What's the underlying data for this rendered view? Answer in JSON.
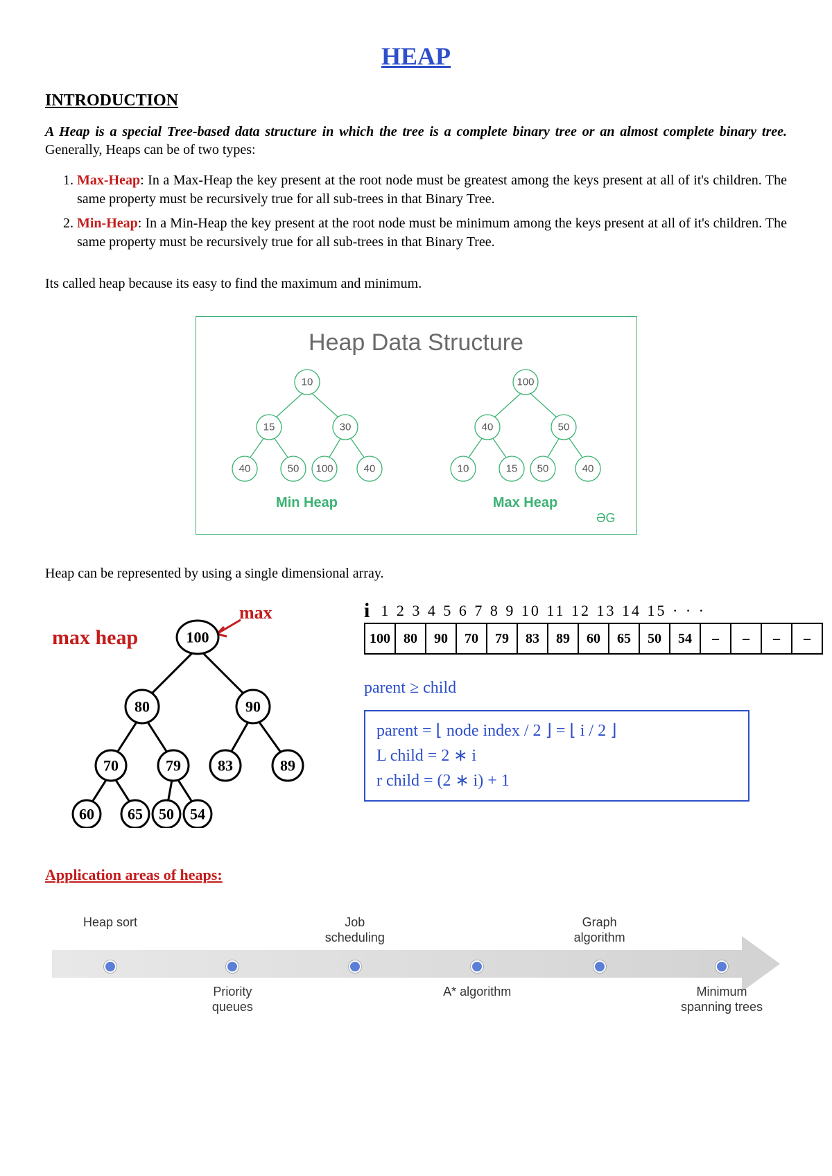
{
  "title": "HEAP",
  "section_intro": "INTRODUCTION",
  "intro_lead": "A Heap is a special Tree-based data structure in which the tree is a complete binary tree or an almost complete binary tree.",
  "intro_tail": " Generally, Heaps can be of two types:",
  "types": [
    {
      "name": "Max-Heap",
      "desc": ": In a Max-Heap the key present at the root node must be greatest among the keys present at all of it's children. The same property must be recursively true for all sub-trees in that Binary Tree."
    },
    {
      "name": "Min-Heap",
      "desc": ": In a Min-Heap the key present at the root node must be minimum among the keys present at all of it's children. The same property must be recursively true for all sub-trees in that Binary Tree."
    }
  ],
  "why_heap": "Its called heap because its easy to find the maximum and minimum.",
  "box_title": "Heap Data Structure",
  "min_heap_label": "Min Heap",
  "max_heap_label": "Max Heap",
  "gfg_mark": "ƏG",
  "min_heap_nodes": [
    "10",
    "15",
    "30",
    "40",
    "50",
    "100",
    "40"
  ],
  "max_heap_nodes": [
    "100",
    "40",
    "50",
    "10",
    "15",
    "50",
    "40"
  ],
  "array_line": "Heap can be represented by using a single dimensional array.",
  "hand_tree_nodes": [
    "100",
    "80",
    "90",
    "70",
    "79",
    "83",
    "89",
    "60",
    "65",
    "50",
    "54"
  ],
  "hand_labels": {
    "max_heap": "max heap",
    "arrow_max": "max"
  },
  "array_index_label": "i",
  "array_indices": "1  2  3  4  5  6  7  8  9  10  11  12  13  14  15 · · ·",
  "array_cells": [
    "100",
    "80",
    "90",
    "70",
    "79",
    "83",
    "89",
    "60",
    "65",
    "50",
    "54",
    "–",
    "–",
    "–",
    "–"
  ],
  "rule_line": "parent ≥ child",
  "formula1": "parent = ⌊ node index / 2 ⌋  =  ⌊ i / 2 ⌋",
  "formula2": "L child = 2 ∗ i",
  "formula3": "r child = (2 ∗ i) + 1",
  "app_head": "Application areas of heaps:",
  "applications": [
    {
      "label": "Heap sort",
      "pos": "top"
    },
    {
      "label": "Priority\nqueues",
      "pos": "bottom"
    },
    {
      "label": "Job\nscheduling",
      "pos": "top"
    },
    {
      "label": "A* algorithm",
      "pos": "bottom"
    },
    {
      "label": "Graph\nalgorithm",
      "pos": "top"
    },
    {
      "label": "Minimum\nspanning trees",
      "pos": "bottom"
    }
  ]
}
